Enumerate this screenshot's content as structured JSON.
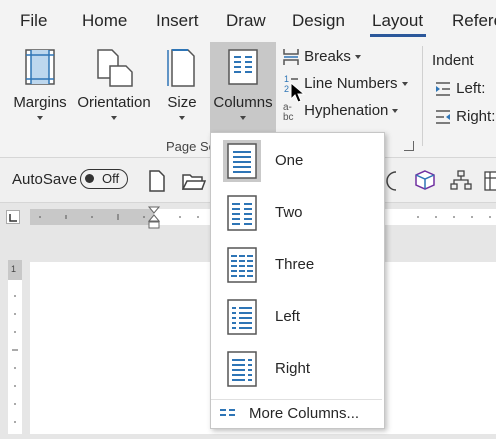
{
  "tabs": [
    "File",
    "Home",
    "Insert",
    "Draw",
    "Design",
    "Layout",
    "Refere"
  ],
  "ribbon": {
    "margins": "Margins",
    "orientation": "Orientation",
    "size": "Size",
    "columns": "Columns",
    "breaks": "Breaks",
    "line_numbers": "Line Numbers",
    "hyphenation": "Hyphenation",
    "group_label": "Page Se",
    "indent_title": "Indent",
    "indent_left": "Left:",
    "indent_right": "Right:"
  },
  "qat": {
    "autosave_label": "AutoSave",
    "autosave_state": "Off"
  },
  "dropdown": {
    "items": [
      "One",
      "Two",
      "Three",
      "Left",
      "Right"
    ],
    "selected": "One",
    "more": "More Columns..."
  },
  "colors": {
    "accent": "#2b579a",
    "icon_blue": "#2e75b6",
    "pressed": "#c8c8c8"
  }
}
